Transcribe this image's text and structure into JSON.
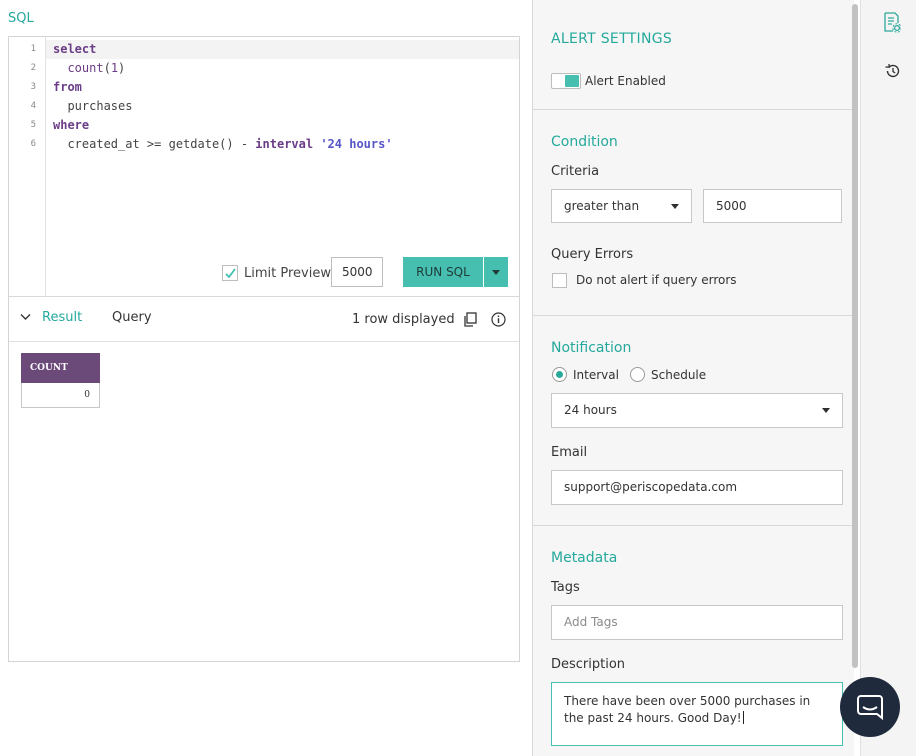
{
  "sql_panel": {
    "title": "SQL",
    "code_lines": [
      {
        "num": "1",
        "text": "select"
      },
      {
        "num": "2",
        "text": "  count(1)"
      },
      {
        "num": "3",
        "text": "from"
      },
      {
        "num": "4",
        "text": "  purchases"
      },
      {
        "num": "5",
        "text": "where"
      },
      {
        "num": "6",
        "text": "  created_at >= getdate() - interval '24 hours'"
      }
    ],
    "limit_preview": {
      "label": "Limit Preview",
      "checked": true,
      "value": "5000"
    },
    "run_button": "RUN SQL"
  },
  "results": {
    "tabs": [
      {
        "label": "Result",
        "active": true
      },
      {
        "label": "Query",
        "active": false
      }
    ],
    "rows_displayed": "1 row displayed",
    "table": {
      "columns": [
        "COUNT"
      ],
      "rows": [
        [
          "0"
        ]
      ]
    }
  },
  "alert_settings": {
    "title": "ALERT SETTINGS",
    "alert_enabled": {
      "label": "Alert Enabled",
      "on": true
    },
    "condition": {
      "title": "Condition",
      "criteria_label": "Criteria",
      "criteria_operator": "greater than",
      "criteria_value": "5000",
      "query_errors_label": "Query Errors",
      "query_errors_option": "Do not alert if query errors",
      "query_errors_checked": false
    },
    "notification": {
      "title": "Notification",
      "modes": [
        {
          "label": "Interval",
          "selected": true
        },
        {
          "label": "Schedule",
          "selected": false
        }
      ],
      "interval_value": "24 hours",
      "email_label": "Email",
      "email_value": "support@periscopedata.com"
    },
    "metadata": {
      "title": "Metadata",
      "tags_label": "Tags",
      "tags_placeholder": "Add Tags",
      "description_label": "Description",
      "description_value": "There have been over 5000 purchases in the past 24 hours. Good Day!"
    }
  },
  "rail": {
    "icons": [
      "alert-settings-icon",
      "history-icon"
    ]
  },
  "chat": {
    "icon": "chat-icon"
  },
  "colors": {
    "accent": "#24a99c",
    "button": "#46bfb1",
    "table_header": "#6b4a7a",
    "chat": "#1f2a3d"
  }
}
